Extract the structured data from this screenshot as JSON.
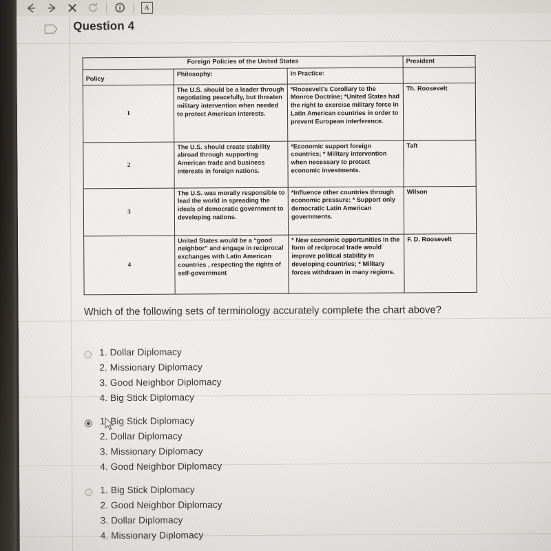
{
  "browser_toolbar": {
    "buttons": [
      {
        "name": "back-icon",
        "glyph": "←"
      },
      {
        "name": "forward-icon",
        "glyph": "→"
      },
      {
        "name": "stop-icon",
        "glyph": "✕"
      },
      {
        "name": "reload-icon",
        "glyph": "⟳"
      },
      {
        "name": "info-icon",
        "glyph": "ⓘ"
      },
      {
        "name": "reader-icon",
        "glyph": "A"
      }
    ]
  },
  "header": {
    "flag_icon": "flag-icon",
    "title": "Question 4"
  },
  "chart_data": {
    "type": "table",
    "title": "Foreign Policies of the United States",
    "columns": [
      "Policy",
      "Philosophy:",
      "In Practice:",
      "President"
    ],
    "rows": [
      {
        "policy": "1",
        "philosophy": "The U.S. should be a leader through negotiating peacefully, but threaten military intervention when needed to protect American interests.",
        "in_practice": "*Roosevelt's Corollary to the Monroe Doctrine; *United States had the right to exercise military force in Latin American countries in order to prevent European interference.",
        "president": "Th. Roosevelt"
      },
      {
        "policy": "2",
        "philosophy": "The U.S. should create stability abroad through supporting American trade and business interests in foreign nations.",
        "in_practice": "*Economic support foreign countries; * Military intervention when necessary to protect economic investments.",
        "president": "Taft"
      },
      {
        "policy": "3",
        "philosophy": "The U.S. was morally responsible to lead the world in spreading the ideals of democratic government to developing nations.",
        "in_practice": "*Influence other countries through economic pressure; * Support only democratic Latin American governments.",
        "president": "Wilson"
      },
      {
        "policy": "4",
        "philosophy": "United States would be a “good neighbor” and engage in reciprocal exchanges with Latin American countries , respecting the rights of self-government",
        "in_practice": "* New economic opportunities in the form of reciprocal trade would improve political stability in developing countries; * Military forces withdrawn in many regions.",
        "president": "F. D. Roosevelt"
      }
    ]
  },
  "question": {
    "prompt": "Which of the following sets of terminology accurately complete the chart above?",
    "options": [
      {
        "selected": false,
        "lines": [
          "1. Dollar Diplomacy",
          "2. Missionary Diplomacy",
          "3. Good Neighbor Diplomacy",
          "4. Big Stick Diplomacy"
        ]
      },
      {
        "selected": true,
        "lines": [
          "1. Big Stick Diplomacy",
          "2. Dollar Diplomacy",
          "3. Missionary Diplomacy",
          "4. Good Neighbor Diplomacy"
        ]
      },
      {
        "selected": false,
        "lines": [
          "1. Big Stick Diplomacy",
          "2. Good Neighbor Diplomacy",
          "3. Dollar Diplomacy",
          "4. Missionary Diplomacy"
        ]
      }
    ]
  },
  "colors": {
    "page_background": "#efedea",
    "text": "#25231f",
    "rule": "#d5d2cd",
    "bezel": "#1d1a18"
  }
}
